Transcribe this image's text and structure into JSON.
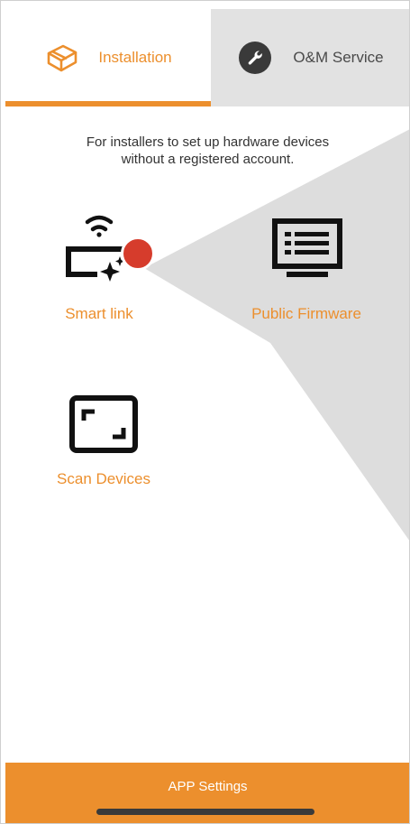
{
  "tabs": {
    "installation": {
      "label": "Installation",
      "icon": "box-icon",
      "active": true
    },
    "om_service": {
      "label": "O&M Service",
      "icon": "wrench-icon",
      "active": false
    }
  },
  "description": {
    "line1": "For installers to set up hardware devices",
    "line2": "without a registered account."
  },
  "tiles": {
    "smart_link": {
      "label": "Smart link",
      "icon": "smart-link-icon",
      "badge_color": "#d63c2c"
    },
    "public_firmware": {
      "label": "Public Firmware",
      "icon": "monitor-icon"
    },
    "scan_devices": {
      "label": "Scan Devices",
      "icon": "scan-frame-icon"
    }
  },
  "bottom_bar": {
    "label": "APP Settings"
  },
  "colors": {
    "accent": "#ec8f2d",
    "inactive_tab": "#e2e2e2",
    "background_shape": "#dddddd",
    "text_dark": "#333333",
    "icon_dark": "#111111"
  }
}
